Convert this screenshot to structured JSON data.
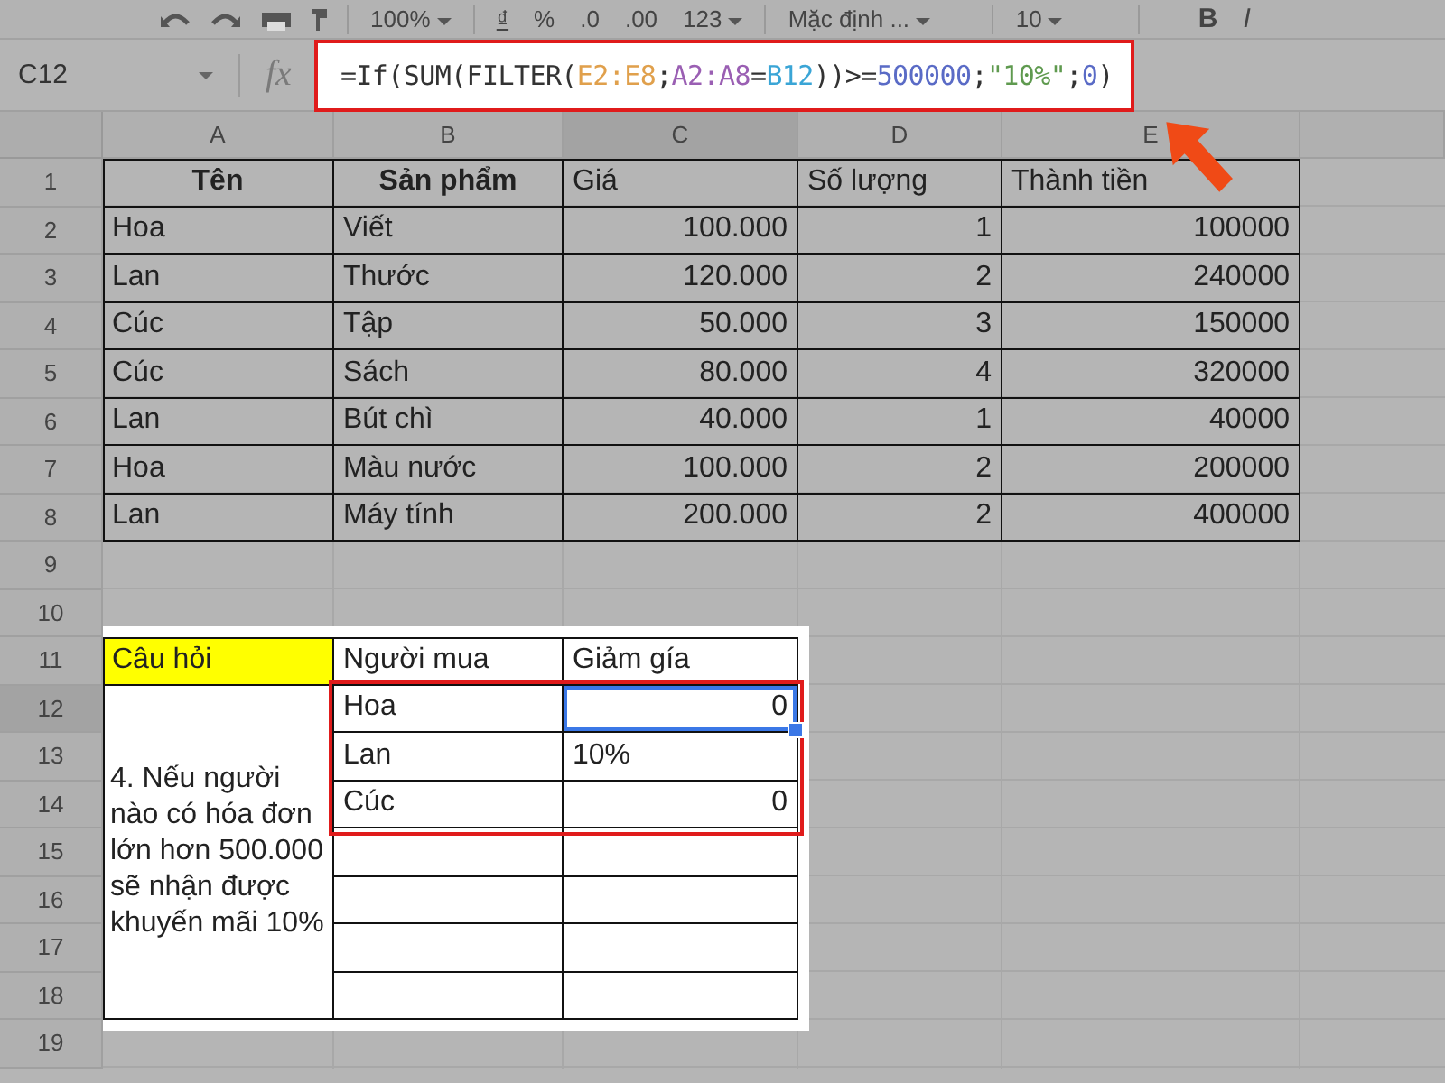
{
  "toolbar": {
    "zoom": "100%",
    "currency": "₫",
    "percent": "%",
    "decimal_decrease": ".0",
    "decimal_increase": ".00",
    "number_format": "123",
    "font": "Mặc định ...",
    "font_size": "10",
    "bold": "B",
    "italic": "I"
  },
  "formula_bar": {
    "name_box": "C12",
    "fx_label": "fx",
    "tokens": [
      {
        "text": "=If(SUM(FILTER(",
        "color": "#333333"
      },
      {
        "text": "E2:E8",
        "color": "#e0a04c"
      },
      {
        "text": ";",
        "color": "#333333"
      },
      {
        "text": "A2:A8",
        "color": "#9a5fb3"
      },
      {
        "text": "=",
        "color": "#333333"
      },
      {
        "text": "B12",
        "color": "#3aa5d6"
      },
      {
        "text": "))>=",
        "color": "#333333"
      },
      {
        "text": "500000",
        "color": "#5a6bc6"
      },
      {
        "text": ";",
        "color": "#333333"
      },
      {
        "text": "\"10%\"",
        "color": "#5f9a4f"
      },
      {
        "text": ";",
        "color": "#333333"
      },
      {
        "text": "0",
        "color": "#5a6bc6"
      },
      {
        "text": ")",
        "color": "#333333"
      }
    ]
  },
  "columns": [
    {
      "label": "A",
      "selected": false
    },
    {
      "label": "B",
      "selected": false
    },
    {
      "label": "C",
      "selected": true
    },
    {
      "label": "D",
      "selected": false
    },
    {
      "label": "E",
      "selected": false
    }
  ],
  "rows": [
    {
      "label": "1",
      "selected": false
    },
    {
      "label": "2",
      "selected": false
    },
    {
      "label": "3",
      "selected": false
    },
    {
      "label": "4",
      "selected": false
    },
    {
      "label": "5",
      "selected": false
    },
    {
      "label": "6",
      "selected": false
    },
    {
      "label": "7",
      "selected": false
    },
    {
      "label": "8",
      "selected": false
    },
    {
      "label": "9",
      "selected": false
    },
    {
      "label": "10",
      "selected": false
    },
    {
      "label": "11",
      "selected": false
    },
    {
      "label": "12",
      "selected": true
    },
    {
      "label": "13",
      "selected": false
    },
    {
      "label": "14",
      "selected": false
    },
    {
      "label": "15",
      "selected": false
    },
    {
      "label": "16",
      "selected": false
    },
    {
      "label": "17",
      "selected": false
    },
    {
      "label": "18",
      "selected": false
    },
    {
      "label": "19",
      "selected": false
    }
  ],
  "data_table": {
    "header": [
      {
        "text": "Tên",
        "bold": true
      },
      {
        "text": "Sản phẩm",
        "bold": true
      },
      {
        "text": "Giá",
        "bold": false
      },
      {
        "text": "Số lượng",
        "bold": false
      },
      {
        "text": "Thành tiền",
        "bold": false
      }
    ],
    "rows": [
      [
        "Hoa",
        "Viết",
        "100.000",
        "1",
        "100000"
      ],
      [
        "Lan",
        "Thước",
        "120.000",
        "2",
        "240000"
      ],
      [
        "Cúc",
        "Tập",
        "50.000",
        "3",
        "150000"
      ],
      [
        "Cúc",
        "Sách",
        "80.000",
        "4",
        "320000"
      ],
      [
        "Lan",
        "Bút chì",
        "40.000",
        "1",
        "40000"
      ],
      [
        "Hoa",
        "Màu nước",
        "100.000",
        "2",
        "200000"
      ],
      [
        "Lan",
        "Máy tính",
        "200.000",
        "2",
        "400000"
      ]
    ]
  },
  "question_table": {
    "header": [
      {
        "text": "Câu hỏi",
        "highlighted": true
      },
      {
        "text": "Người mua",
        "highlighted": false
      },
      {
        "text": "Giảm gía",
        "highlighted": false
      }
    ],
    "question": "4. Nếu người nào có hóa đơn lớn hơn 500.000 sẽ nhận được khuyến mãi 10%",
    "rows": [
      {
        "cells": [
          {
            "value": "Hoa",
            "kind": "text",
            "selected": false
          },
          {
            "value": "0",
            "kind": "number",
            "selected": true
          }
        ]
      },
      {
        "cells": [
          {
            "value": "Lan",
            "kind": "text",
            "selected": false
          },
          {
            "value": "10%",
            "kind": "text",
            "selected": false
          }
        ]
      },
      {
        "cells": [
          {
            "value": "Cúc",
            "kind": "text",
            "selected": false
          },
          {
            "value": "0",
            "kind": "number",
            "selected": false
          }
        ]
      }
    ]
  }
}
